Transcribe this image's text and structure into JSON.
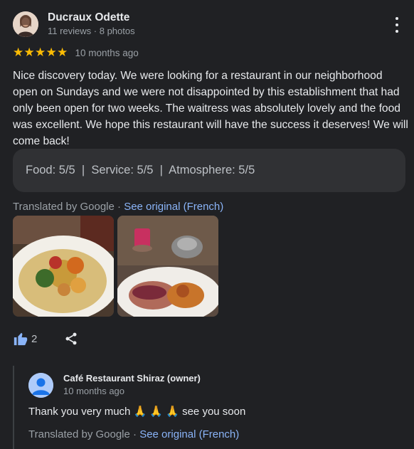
{
  "review": {
    "author_name": "Ducraux Odette",
    "author_meta": "11 reviews · 8 photos",
    "rating": 5,
    "stars": [
      "★",
      "★",
      "★",
      "★",
      "★"
    ],
    "date": "10 months ago",
    "text": "Nice discovery today. We were looking for a restaurant in our neighborhood open on Sundays and we were not disappointed by this establishment that had only been open for two weeks. The waitress was absolutely lovely and the food was excellent. We hope this restaurant will have the success it deserves! We will come back!",
    "sub_ratings": "Food: 5/5  |  Service: 5/5  |  Atmosphere: 5/5",
    "translated_label": "Translated by Google",
    "separator": " · ",
    "see_original": "See original (French)",
    "likes": "2",
    "icons": {
      "more": "more-vert-icon",
      "like": "thumb-up-icon",
      "share": "share-icon"
    }
  },
  "owner_reply": {
    "name": "Café Restaurant Shiraz (owner)",
    "date": "10 months ago",
    "text": "Thank you very much 🙏 🙏 🙏 see you soon",
    "translated_label": "Translated by Google",
    "separator": " · ",
    "see_original": "See original (French)"
  },
  "colors": {
    "background": "#202124",
    "star": "#fbbc04",
    "link": "#8ab4f8",
    "like": "#8ab4f8"
  }
}
